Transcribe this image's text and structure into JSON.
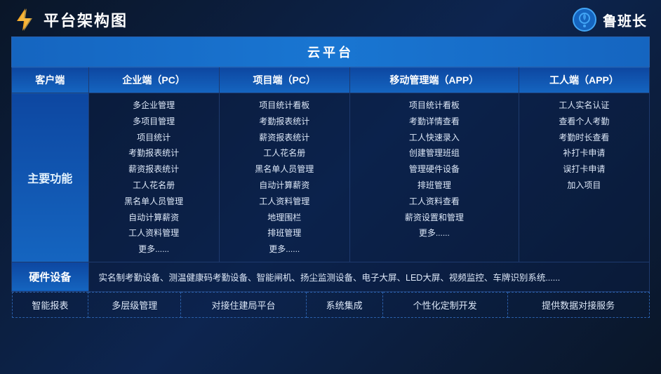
{
  "header": {
    "title": "平台架构图",
    "brand_name": "鲁班长"
  },
  "cloud_platform": {
    "label": "云平台"
  },
  "columns": {
    "client": "客户端",
    "enterprise_pc": "企业端（PC）",
    "project_pc": "项目端（PC）",
    "mobile_app": "移动管理端（APP）",
    "worker_app": "工人端（APP）"
  },
  "main_function_label": "主要功能",
  "enterprise_features": [
    "多企业管理",
    "多项目管理",
    "项目统计",
    "考勤报表统计",
    "薪资报表统计",
    "工人花名册",
    "黑名单人员管理",
    "自动计算薪资",
    "工人资料管理",
    "更多......"
  ],
  "project_features": [
    "项目统计看板",
    "考勤报表统计",
    "薪资报表统计",
    "工人花名册",
    "黑名单人员管理",
    "自动计算薪资",
    "工人资料管理",
    "地理围栏",
    "排班管理",
    "更多......"
  ],
  "mobile_features": [
    "项目统计看板",
    "考勤详情查看",
    "工人快速录入",
    "创建管理班组",
    "管理硬件设备",
    "排班管理",
    "工人资料查看",
    "薪资设置和管理",
    "更多......"
  ],
  "worker_features": [
    "工人实名认证",
    "查看个人考勤",
    "考勤时长查看",
    "补打卡申请",
    "误打卡申请",
    "加入项目"
  ],
  "hardware": {
    "label": "硬件设备",
    "content": "实名制考勤设备、测温健康码考勤设备、智能闸机、扬尘监测设备、电子大屏、LED大屏、视频监控、车牌识别系统......"
  },
  "bottom_features": [
    "智能报表",
    "多层级管理",
    "对接住建局平台",
    "系统集成",
    "个性化定制开发",
    "提供数据对接服务"
  ]
}
